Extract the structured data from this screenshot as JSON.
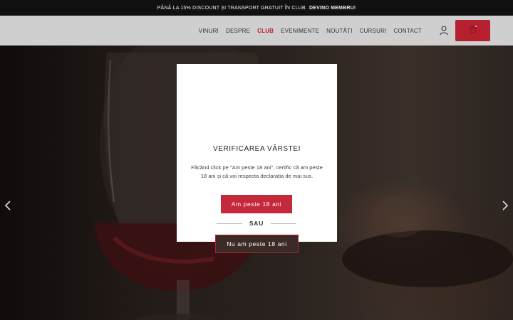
{
  "announcement": {
    "text": "PÂNĂ LA 15% DISCOUNT ȘI TRANSPORT GRATUIT ÎN CLUB.",
    "link": "DEVINO MEMBRU!"
  },
  "nav": {
    "items": [
      {
        "label": "VINURI"
      },
      {
        "label": "DESPRE"
      },
      {
        "label": "CLUB"
      },
      {
        "label": "EVENIMENTE"
      },
      {
        "label": "NOUTĂȚI"
      },
      {
        "label": "CURSURI"
      },
      {
        "label": "CONTACT"
      }
    ],
    "active": "CLUB"
  },
  "icons": {
    "user": "user-icon",
    "cart": "cart-icon",
    "prev": "chevron-left-icon",
    "next": "chevron-right-icon"
  },
  "age_modal": {
    "title": "VERIFICAREA VÂRSTEI",
    "text": "Făcând click pe \"Am peste 18 ani\", certific că am peste 18 ani și că voi respecta declarația de mai sus.",
    "confirm_label": "Am peste 18 ani",
    "separator": "SAU",
    "decline_label": "Nu am peste 18 ani"
  },
  "colors": {
    "accent": "#b5202f",
    "header_bg": "#cfcfcf",
    "topbar_bg": "#111111"
  }
}
